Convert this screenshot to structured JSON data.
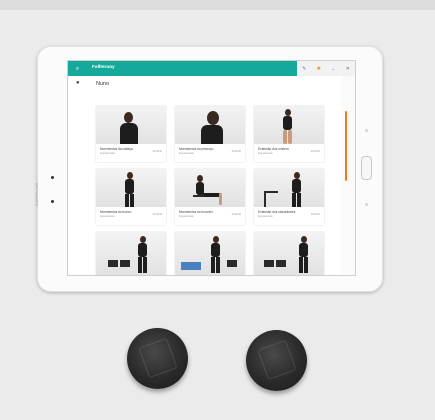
{
  "device": {
    "brand": "SAMSUNG"
  },
  "app": {
    "title": "Fallteraoy",
    "user_name": "Nuno"
  },
  "icons": {
    "menu": "hamburger-menu-icon",
    "user": "person-icon",
    "pencil": "pencil-icon",
    "settings": "gear-icon",
    "chevron": "chevron-down-icon",
    "close": "close-icon"
  },
  "colors": {
    "appbar": "#14a99b",
    "scroll_accent": "#f07a1e"
  },
  "exercises": [
    {
      "title": "Movimentos da cabeça",
      "sub": "Exposicionais",
      "meta": "00:00:00"
    },
    {
      "title": "Movimentos do pescoço",
      "sub": "Exposicionais",
      "meta": "00:00:00"
    },
    {
      "title": "Extensão dos ombros",
      "sub": "Exposicionais",
      "meta": "00:00:00"
    },
    {
      "title": "Movimentos do tronco",
      "sub": "Exposicionais",
      "meta": "00:00:00"
    },
    {
      "title": "Movimentos do tronzelo",
      "sub": "Exposicionais",
      "meta": "00:00:00"
    },
    {
      "title": "Extensão dos calcanhares",
      "sub": "Exposicionais",
      "meta": "00:00:00"
    },
    {
      "title": "",
      "sub": "",
      "meta": ""
    },
    {
      "title": "",
      "sub": "",
      "meta": ""
    },
    {
      "title": "",
      "sub": "",
      "meta": ""
    }
  ]
}
